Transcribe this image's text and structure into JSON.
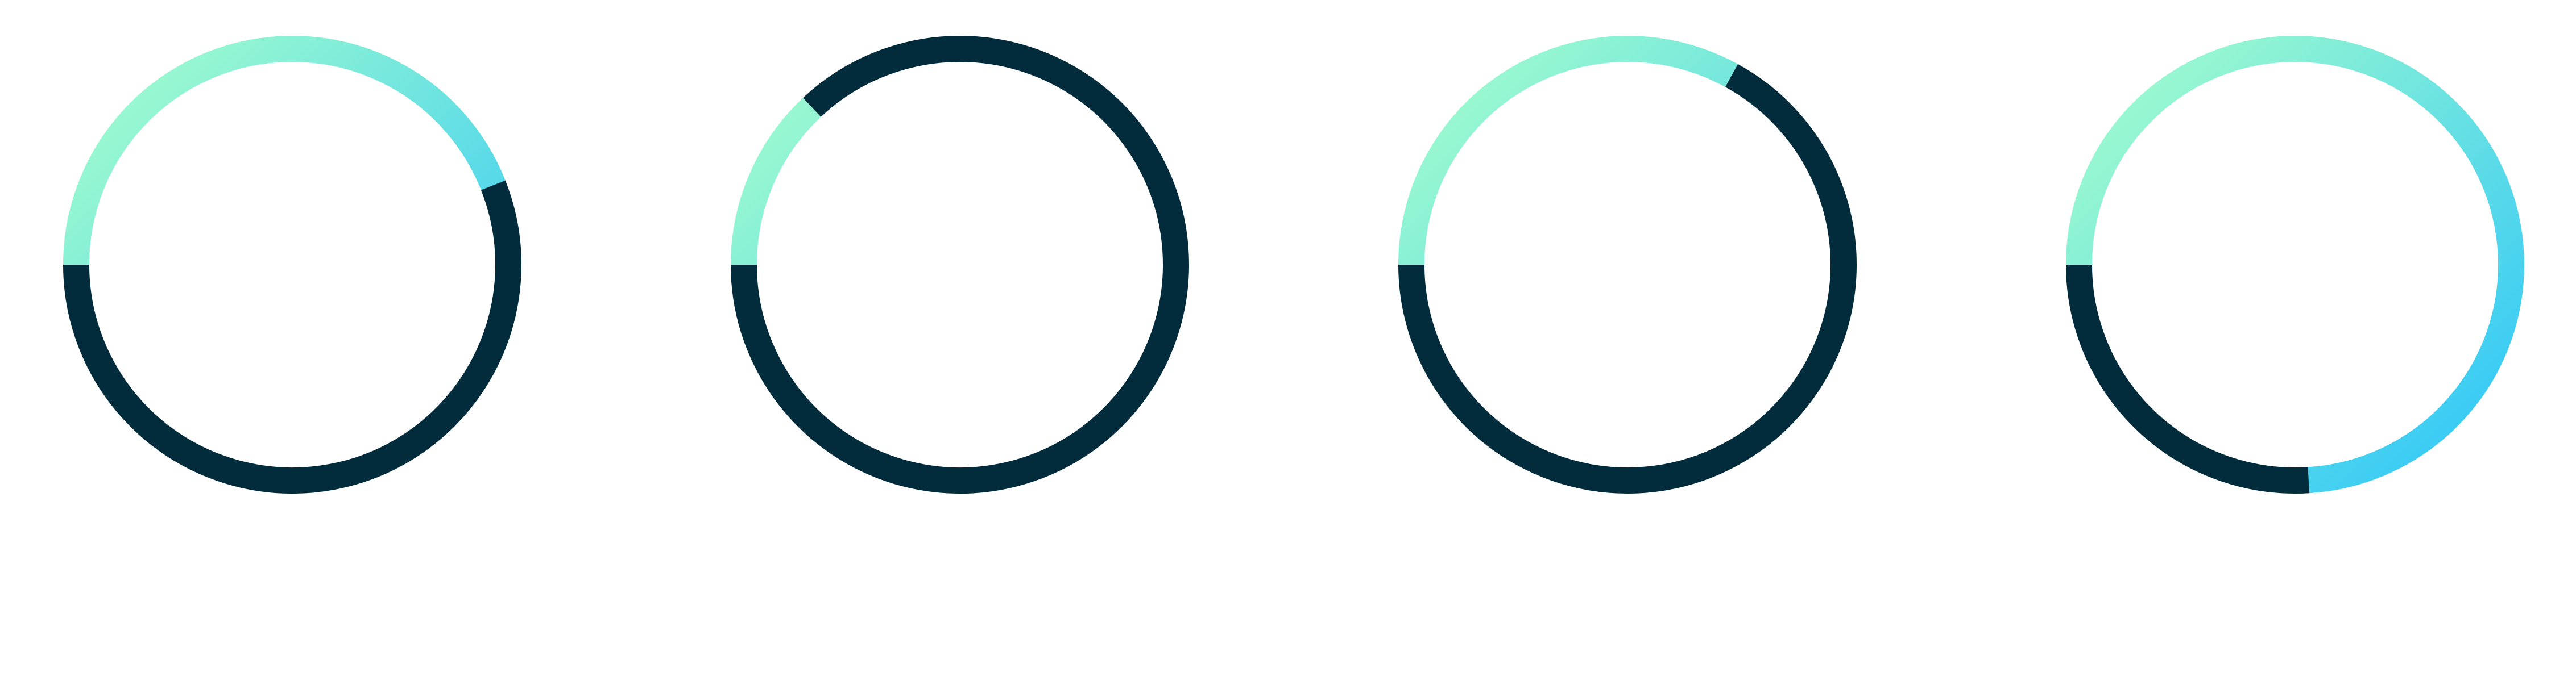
{
  "chart_data": [
    {
      "type": "gauge",
      "value": 0.56,
      "gradient": {
        "start": "#a8ffca",
        "end": "#2bc4fa"
      },
      "fill_color": "#022c3c",
      "background_color": "#ffffff"
    },
    {
      "type": "gauge",
      "value": 0.87,
      "gradient": {
        "start": "#a8ffca",
        "end": "#2bc4fa"
      },
      "fill_color": "#022c3c",
      "background_color": "#ffffff"
    },
    {
      "type": "gauge",
      "value": 0.67,
      "gradient": {
        "start": "#a8ffca",
        "end": "#2bc4fa"
      },
      "fill_color": "#022c3c",
      "background_color": "#ffffff"
    },
    {
      "type": "gauge",
      "value": 0.26,
      "gradient": {
        "start": "#a8ffca",
        "end": "#2bc4fa"
      },
      "fill_color": "#022c3c",
      "background_color": "#ffffff"
    }
  ]
}
